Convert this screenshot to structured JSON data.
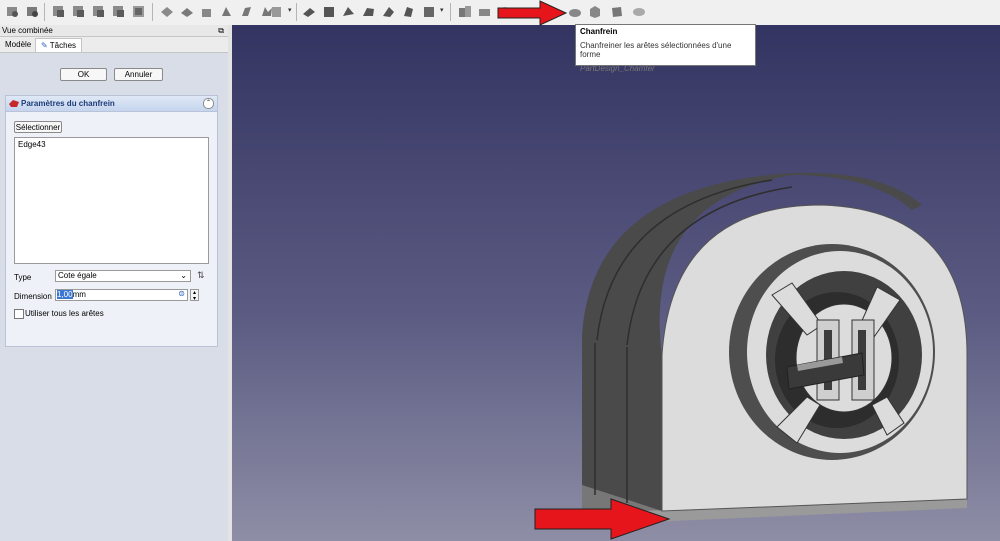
{
  "toolbar": {
    "icons": [
      "view-fit-icon",
      "view-selection-icon",
      "view-front-icon",
      "view-top-icon",
      "view-right-icon",
      "view-rear-icon",
      "view-isometric-icon",
      "sketch-icon",
      "pad-icon",
      "pocket-icon",
      "revolution-icon",
      "groove-icon",
      "additive-loft-icon",
      "body-icon",
      "part-icon",
      "datum-plane-icon",
      "datum-line-icon",
      "additive-pipe-icon",
      "subtractive-loft-icon",
      "hole-icon",
      "helix-icon",
      "mirror-icon",
      "linear-pattern-icon",
      "polar-pattern-icon",
      "multi-transform-icon",
      "fillet-icon",
      "chamfer-icon",
      "draft-icon",
      "thickness-icon",
      "boolean-icon"
    ]
  },
  "panel": {
    "title": "Vue combinée",
    "tabs": [
      "Modèle",
      "Tâches"
    ],
    "ok_label": "OK",
    "cancel_label": "Annuler",
    "box_title": "Paramètres du chanfrein",
    "select_label": "Sélectionner",
    "edges": [
      "Edge43"
    ],
    "type_label": "Type",
    "type_value": "Cote égale",
    "dimension_label": "Dimension",
    "dimension_value": "1,00",
    "dimension_unit": "mm",
    "use_all_label": "Utiliser tous les arêtes",
    "use_all_checked": false
  },
  "tooltip": {
    "title": "Chanfrein",
    "description": "Chanfreiner les arêtes sélectionnées d'une forme",
    "command": "PartDesign_Chamfer"
  },
  "colors": {
    "viewport_top": "#343462",
    "viewport_bottom": "#8e8ea6",
    "arrow": "#e5151b",
    "part_light": "#dcdcdc",
    "part_dark": "#4a4a4a"
  }
}
